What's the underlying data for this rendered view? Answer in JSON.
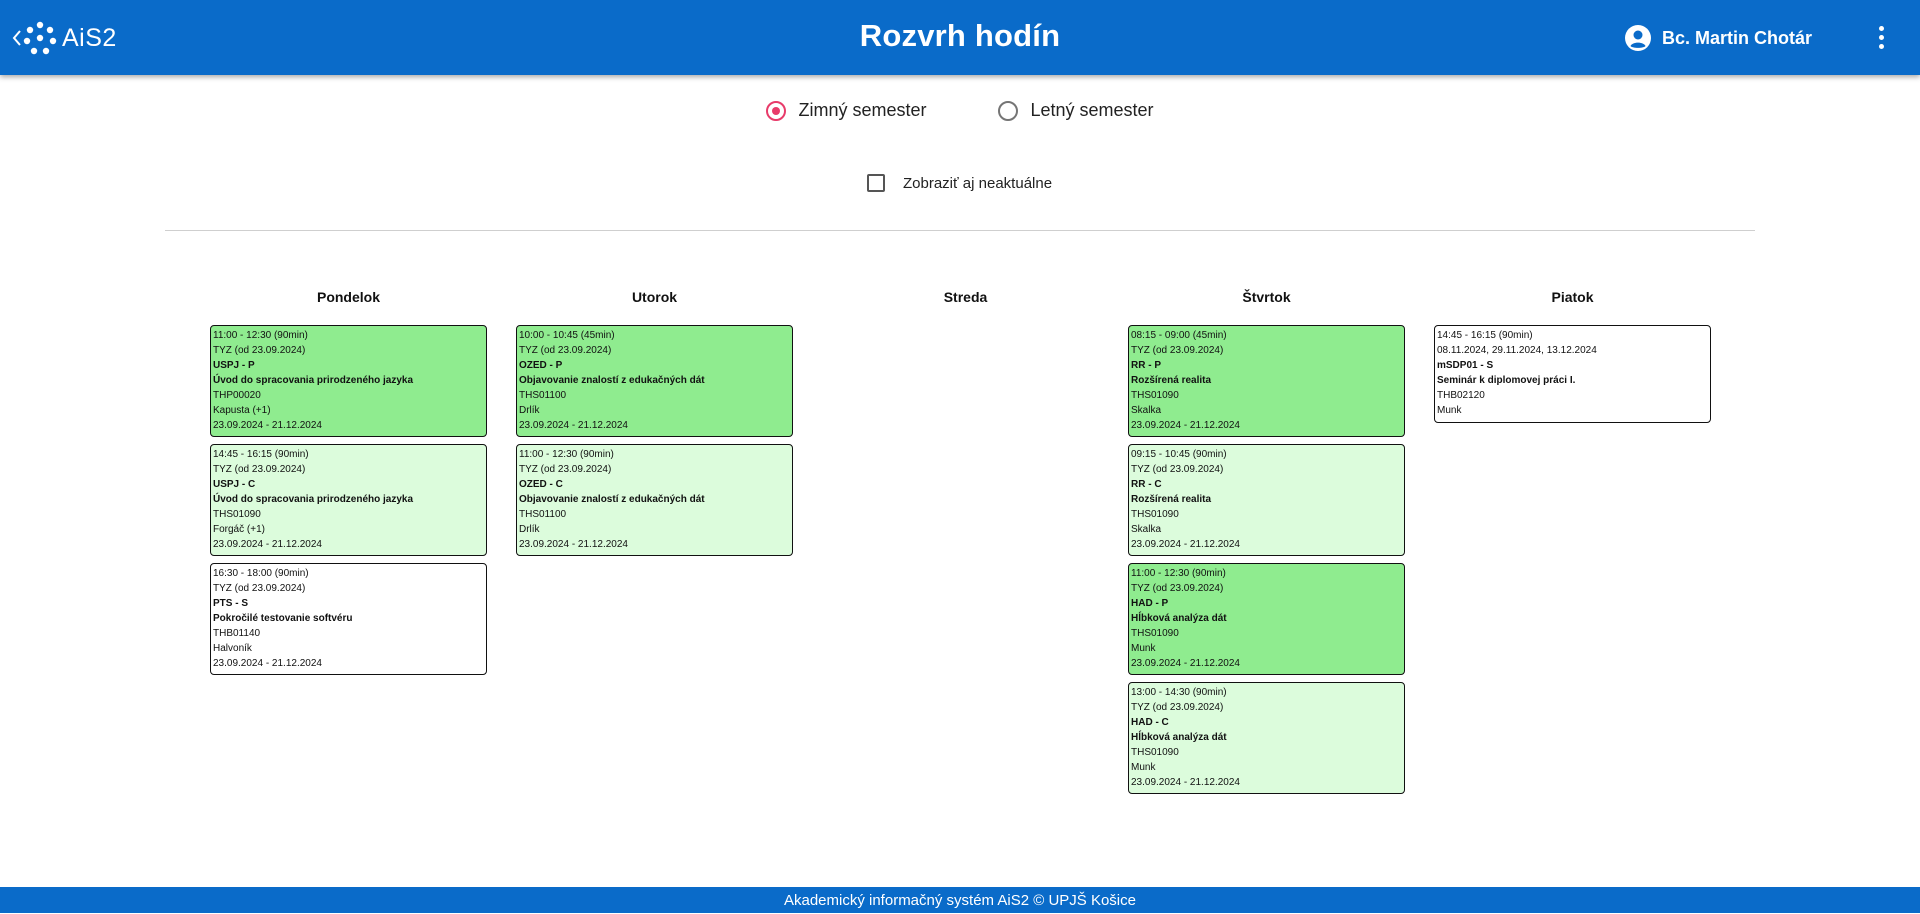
{
  "header": {
    "brand": "AiS2",
    "title": "Rozvrh hodín",
    "user_name": "Bc. Martin Chotár"
  },
  "semester": {
    "options": [
      {
        "label": "Zimný semester",
        "selected": true
      },
      {
        "label": "Letný semester",
        "selected": false
      }
    ]
  },
  "show_inactive": {
    "label": "Zobraziť aj neaktuálne",
    "checked": false
  },
  "days": [
    {
      "name": "Pondelok",
      "events": [
        {
          "type": "lecture",
          "time": "11:00 - 12:30 (90min)",
          "week": "TYZ (od 23.09.2024)",
          "code": "USPJ - P",
          "subject": "Úvod do spracovania prirodzeného jazyka",
          "room": "THP00020",
          "teacher": "Kapusta (+1)",
          "dates": "23.09.2024 - 21.12.2024"
        },
        {
          "type": "seminar",
          "time": "14:45 - 16:15 (90min)",
          "week": "TYZ (od 23.09.2024)",
          "code": "USPJ - C",
          "subject": "Úvod do spracovania prirodzeného jazyka",
          "room": "THS01090",
          "teacher": "Forgáč (+1)",
          "dates": "23.09.2024 - 21.12.2024"
        },
        {
          "type": "other",
          "time": "16:30 - 18:00 (90min)",
          "week": "TYZ (od 23.09.2024)",
          "code": "PTS - S",
          "subject": "Pokročilé testovanie softvéru",
          "room": "THB01140",
          "teacher": "Halvoník",
          "dates": "23.09.2024 - 21.12.2024"
        }
      ]
    },
    {
      "name": "Utorok",
      "events": [
        {
          "type": "lecture",
          "time": "10:00 - 10:45 (45min)",
          "week": "TYZ (od 23.09.2024)",
          "code": "OZED - P",
          "subject": "Objavovanie znalostí z edukačných dát",
          "room": "THS01100",
          "teacher": "Drlík",
          "dates": "23.09.2024 - 21.12.2024"
        },
        {
          "type": "seminar",
          "time": "11:00 - 12:30 (90min)",
          "week": "TYZ (od 23.09.2024)",
          "code": "OZED - C",
          "subject": "Objavovanie znalostí z edukačných dát",
          "room": "THS01100",
          "teacher": "Drlík",
          "dates": "23.09.2024 - 21.12.2024"
        }
      ]
    },
    {
      "name": "Streda",
      "events": []
    },
    {
      "name": "Štvrtok",
      "events": [
        {
          "type": "lecture",
          "time": "08:15 - 09:00 (45min)",
          "week": "TYZ (od 23.09.2024)",
          "code": "RR - P",
          "subject": "Rozšírená realita",
          "room": "THS01090",
          "teacher": "Skalka",
          "dates": "23.09.2024 - 21.12.2024"
        },
        {
          "type": "seminar",
          "time": "09:15 - 10:45 (90min)",
          "week": "TYZ (od 23.09.2024)",
          "code": "RR - C",
          "subject": "Rozšírená realita",
          "room": "THS01090",
          "teacher": "Skalka",
          "dates": "23.09.2024 - 21.12.2024"
        },
        {
          "type": "lecture",
          "time": "11:00 - 12:30 (90min)",
          "week": "TYZ (od 23.09.2024)",
          "code": "HAD - P",
          "subject": "Hĺbková analýza dát",
          "room": "THS01090",
          "teacher": "Munk",
          "dates": "23.09.2024 - 21.12.2024"
        },
        {
          "type": "seminar",
          "time": "13:00 - 14:30 (90min)",
          "week": "TYZ (od 23.09.2024)",
          "code": "HAD - C",
          "subject": "Hĺbková analýza dát",
          "room": "THS01090",
          "teacher": "Munk",
          "dates": "23.09.2024 - 21.12.2024"
        }
      ]
    },
    {
      "name": "Piatok",
      "events": [
        {
          "type": "other",
          "short": true,
          "time": "14:45 - 16:15 (90min)",
          "week": "08.11.2024, 29.11.2024, 13.12.2024",
          "code": "mSDP01 - S",
          "subject": "Seminár k diplomovej práci I.",
          "room": "THB02120",
          "teacher": "Munk",
          "dates": ""
        }
      ]
    }
  ],
  "footer": {
    "text": "Akademický informačný systém AiS2 © UPJŠ Košice"
  },
  "colors": {
    "header": "#0a6bc9",
    "lecture": "#8fec8f",
    "seminar": "#dcfcdc",
    "radio_accent": "#e83b6a"
  }
}
